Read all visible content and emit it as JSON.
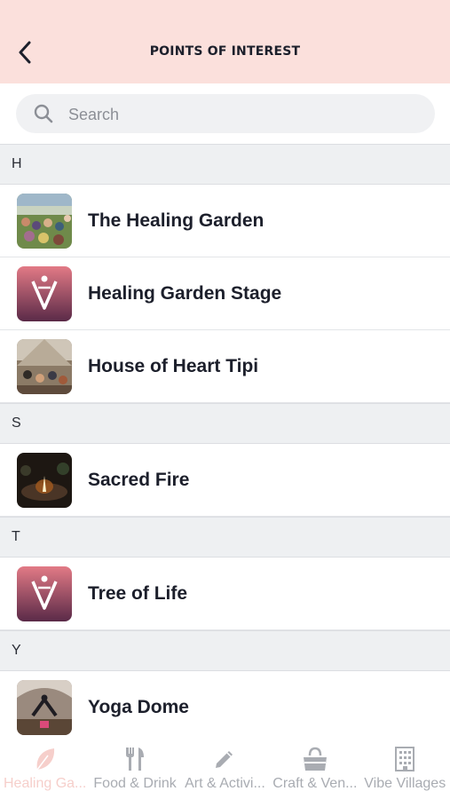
{
  "header": {
    "title": "POINTS OF INTEREST",
    "back_icon": "chevron-left-icon",
    "background": "#fbe0dc"
  },
  "search": {
    "placeholder": "Search",
    "icon": "search-icon"
  },
  "sections": [
    {
      "letter": "H",
      "items": [
        {
          "label": "The Healing Garden",
          "thumb": "crowd-photo"
        },
        {
          "label": "Healing Garden Stage",
          "thumb": "brand-logo"
        },
        {
          "label": "House of Heart Tipi",
          "thumb": "tipi-photo"
        }
      ]
    },
    {
      "letter": "S",
      "items": [
        {
          "label": "Sacred Fire",
          "thumb": "fire-photo"
        }
      ]
    },
    {
      "letter": "T",
      "items": [
        {
          "label": "Tree of Life",
          "thumb": "brand-logo"
        }
      ]
    },
    {
      "letter": "Y",
      "items": [
        {
          "label": "Yoga Dome",
          "thumb": "yoga-photo"
        }
      ]
    }
  ],
  "tabs": [
    {
      "label": "Healing Ga...",
      "icon": "leaf-icon",
      "active": true
    },
    {
      "label": "Food & Drink",
      "icon": "fork-knife-icon",
      "active": false
    },
    {
      "label": "Art & Activi...",
      "icon": "pencil-icon",
      "active": false
    },
    {
      "label": "Craft & Ven...",
      "icon": "shopping-bag-icon",
      "active": false
    },
    {
      "label": "Vibe Villages",
      "icon": "building-icon",
      "active": false
    }
  ],
  "colors": {
    "accent": "#fbe0dc",
    "active_tab": "#f6cfcb",
    "inactive_tab": "#a9acb2",
    "text": "#1c1f2b"
  }
}
